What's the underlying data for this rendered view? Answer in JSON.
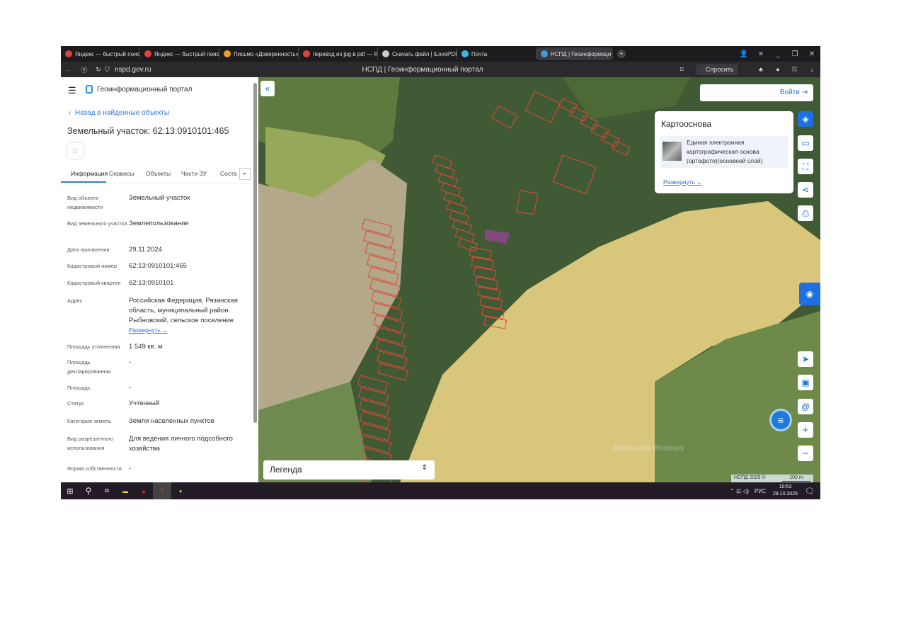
{
  "browser": {
    "tabs": [
      {
        "label": "Яндекс — быстрый поиск",
        "icon": "yandex-icon",
        "color": "#e0413a"
      },
      {
        "label": "Яндекс — быстрый поиск",
        "icon": "yandex-icon",
        "color": "#e0413a"
      },
      {
        "label": "Письмо «Доверенность»",
        "icon": "mail-icon",
        "color": "#f0a020"
      },
      {
        "label": "перевод из jpg в pdf — Я",
        "icon": "yandex-icon",
        "color": "#e0413a"
      },
      {
        "label": "Скачать файл | iLovePDF",
        "icon": "file-icon",
        "color": "#ccc"
      },
      {
        "label": "Почта",
        "icon": "mail-icon",
        "color": "#3fb6e8"
      },
      {
        "label": "НСПД | Геоинформаци",
        "icon": "nspd-icon",
        "color": "#3a9be0",
        "active": true
      }
    ],
    "url": "nspd.gov.ru",
    "page_title": "НСПД | Геоинформационный портал",
    "ask_label": "Спросить"
  },
  "panel": {
    "app_title": "Геоинформационный портал",
    "back_label": "Назад в найденные объекты",
    "title": "Земельный участок: 62:13:0910101:465",
    "tabs": [
      "Информация",
      "Сервисы",
      "Объекты",
      "Части ЗУ",
      "Соста"
    ],
    "fields": [
      {
        "label": "Вид объекта недвижимости",
        "value": "Земельный участок"
      },
      {
        "label": "Вид земельного участка",
        "value": "Землепользование"
      },
      {
        "label": "Дата присвоения",
        "value": "29.11.2024"
      },
      {
        "label": "Кадастровый номер",
        "value": "62:13:0910101:465"
      },
      {
        "label": "Кадастровый квартал",
        "value": "62:13:0910101"
      },
      {
        "label": "Адрес",
        "value": "Российская Федерация, Рязанская область, муниципальный район Рыбновский, сельское поселение"
      },
      {
        "label": "Площадь уточненная",
        "value": "1 549 кв. м"
      },
      {
        "label": "Площадь декларированная",
        "value": "-"
      },
      {
        "label": "Площадь",
        "value": "-"
      },
      {
        "label": "Статус",
        "value": "Учтенный"
      },
      {
        "label": "Категория земель",
        "value": "Земли населенных пунктов"
      },
      {
        "label": "Вид разрешенного использования",
        "value": "Для ведения личного подсобного хозяйства"
      },
      {
        "label": "Форма собственности",
        "value": "-"
      }
    ],
    "expand_label": "Развернуть"
  },
  "map": {
    "login_label": "Войти",
    "basemap_title": "Картооснова",
    "basemap_layer": "Единая электронная картографическая основа (ортофото)(основной слой)",
    "expand_label": "Развернуть",
    "legend_label": "Легенда",
    "copyright": "НСПД 2025 ©",
    "scale": "100 m",
    "watermark": "Активация Windows",
    "accent": "#1f6fe0"
  },
  "taskbar": {
    "lang": "РУС",
    "time": "10:53",
    "date": "28.10.2025"
  }
}
